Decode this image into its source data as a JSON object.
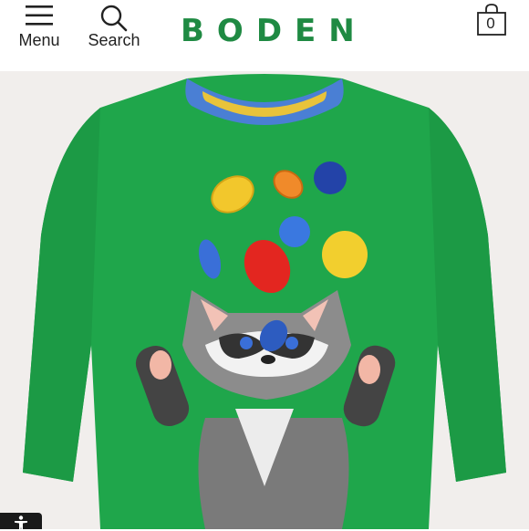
{
  "header": {
    "menu_label": "Menu",
    "search_label": "Search",
    "brand": "BODEN",
    "bag_count": "0"
  },
  "product_image": {
    "subject": "green long-sleeve t-shirt with raccoon and leaves appliqué"
  },
  "colors": {
    "brand_green": "#1f8a43",
    "shirt_green": "#1fa64b",
    "background": "#f1eeec"
  },
  "icons": [
    "hamburger-icon",
    "search-icon",
    "shopping-bag-icon",
    "accessibility-icon"
  ]
}
